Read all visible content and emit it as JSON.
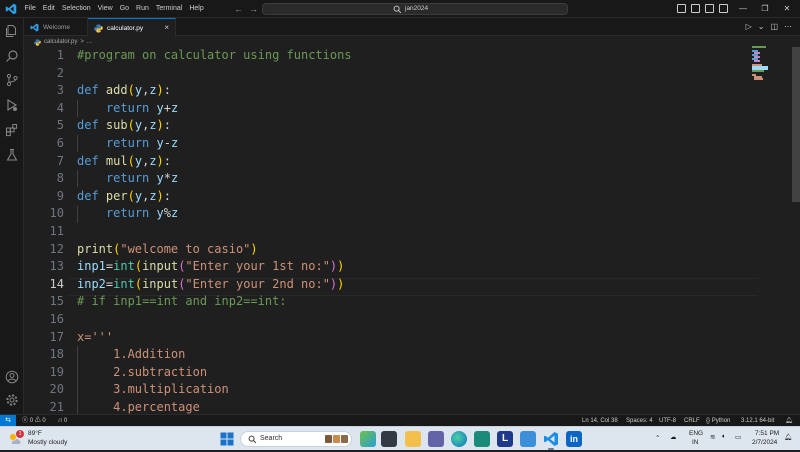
{
  "titlebar": {
    "menu": [
      "File",
      "Edit",
      "Selection",
      "View",
      "Go",
      "Run",
      "Terminal",
      "Help"
    ],
    "search_text": "jan2024"
  },
  "tabs": {
    "welcome_label": "Welcome",
    "active_label": "calculator.py",
    "close_glyph": "×"
  },
  "breadcrumb": {
    "file": "calculator.py",
    "separator": ">",
    "rest": "..."
  },
  "editor": {
    "line_numbers": [
      "1",
      "2",
      "3",
      "4",
      "5",
      "6",
      "7",
      "8",
      "9",
      "10",
      "11",
      "12",
      "13",
      "14",
      "15",
      "16",
      "17",
      "18",
      "19",
      "20",
      "21"
    ],
    "active_line": "14",
    "lines": [
      "#program on calculator using functions",
      "",
      "def add(y,z):",
      "    return y+z",
      "def sub(y,z):",
      "    return y-z",
      "def mul(y,z):",
      "    return y*z",
      "def per(y,z):",
      "    return y%z",
      "",
      "print(\"welcome to casio\")",
      "inp1=int(input(\"Enter your 1st no:\"))",
      "inp2=int(input(\"Enter your 2nd no:\"))",
      "# if inp1==int and inp2==int:",
      "",
      "x='''",
      "     1.Addition",
      "     2.subtraction",
      "     3.multiplication",
      "     4.percentage"
    ]
  },
  "statusbar": {
    "remote_glyph": "⇆",
    "errors": "0",
    "warnings": "0",
    "ports": "0",
    "position": "Ln 14, Col 38",
    "spaces": "Spaces: 4",
    "encoding": "UTF-8",
    "eol": "CRLF",
    "language": "Python",
    "interpreter": "3.12.1 64-bit"
  },
  "taskbar": {
    "weather_badge": "1",
    "weather_temp": "89°F",
    "weather_desc": "Mostly cloudy",
    "search_label": "Search",
    "lang_top": "ENG",
    "lang_bottom": "IN",
    "time": "7:51 PM",
    "date": "2/7/2024"
  },
  "colors": {
    "accent": "#0078d4",
    "comment": "#6a9955",
    "keyword": "#569cd6",
    "function": "#dcdcaa",
    "string": "#ce9178",
    "type": "#4ec9b0",
    "parameter": "#9cdcfe"
  },
  "icons": {
    "activity_bar": [
      "explorer-icon",
      "search-icon",
      "source-control-icon",
      "run-debug-icon",
      "extensions-icon",
      "testing-icon",
      "account-icon",
      "manage-gear-icon"
    ],
    "taskbar_apps": [
      "file-explorer-app",
      "widgets-app",
      "store-app",
      "teams-app",
      "edge-app",
      "photos-app",
      "l-app",
      "paint-app",
      "vscode-app",
      "linkedin-app"
    ]
  }
}
